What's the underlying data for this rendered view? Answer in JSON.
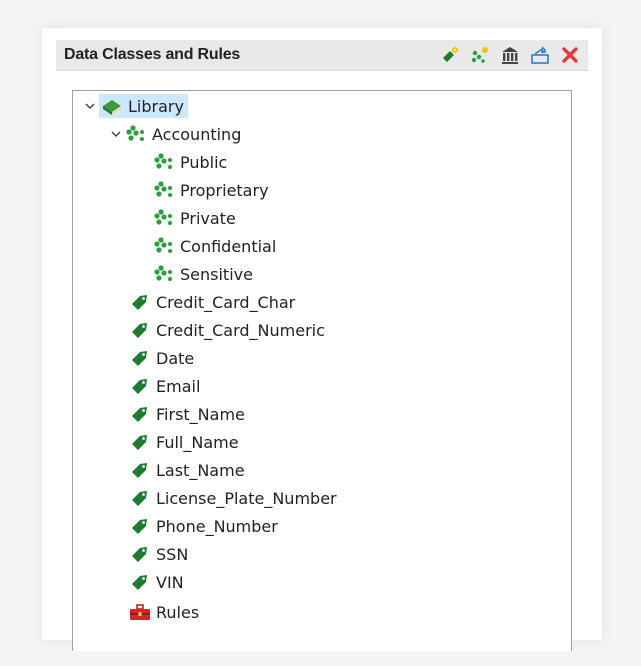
{
  "panel": {
    "title": "Data Classes and Rules",
    "toolbar": [
      {
        "name": "new-data-class-icon"
      },
      {
        "name": "new-data-class-group-icon"
      },
      {
        "name": "library-icon"
      },
      {
        "name": "import-icon"
      },
      {
        "name": "delete-icon"
      }
    ]
  },
  "tree": {
    "root": {
      "label": "Library",
      "expanded": true,
      "selected": true
    },
    "group": {
      "label": "Accounting",
      "expanded": true,
      "children": [
        "Public",
        "Proprietary",
        "Private",
        "Confidential",
        "Sensitive"
      ]
    },
    "classes": [
      "Credit_Card_Char",
      "Credit_Card_Numeric",
      "Date",
      "Email",
      "First_Name",
      "Full_Name",
      "Last_Name",
      "License_Plate_Number",
      "Phone_Number",
      "SSN",
      "VIN"
    ],
    "rules": {
      "label": "Rules"
    }
  },
  "colors": {
    "tag_green": "#1e7a2e",
    "dots_green": "#2e9d3c",
    "selection": "#cce8ff",
    "delete_red": "#e03a3a"
  }
}
